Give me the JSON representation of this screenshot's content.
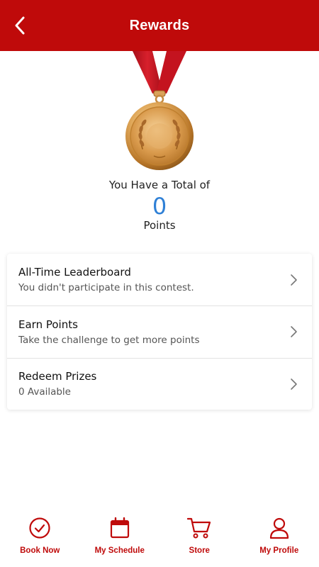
{
  "header": {
    "title": "Rewards",
    "back_icon": "chevron-left-icon"
  },
  "summary": {
    "total_label": "You Have a Total of",
    "points_value": "0",
    "points_label": "Points"
  },
  "menu": {
    "items": [
      {
        "title": "All-Time Leaderboard",
        "subtitle": "You didn't participate in this contest."
      },
      {
        "title": "Earn Points",
        "subtitle": "Take the challenge to get more points"
      },
      {
        "title": "Redeem Prizes",
        "subtitle": "0 Available"
      }
    ]
  },
  "nav": {
    "items": [
      {
        "label": "Book Now",
        "icon": "check-circle-icon"
      },
      {
        "label": "My Schedule",
        "icon": "calendar-icon"
      },
      {
        "label": "Store",
        "icon": "cart-icon"
      },
      {
        "label": "My Profile",
        "icon": "user-icon"
      }
    ]
  },
  "colors": {
    "brand": "#bf0a0a",
    "accent": "#2f80d6"
  }
}
